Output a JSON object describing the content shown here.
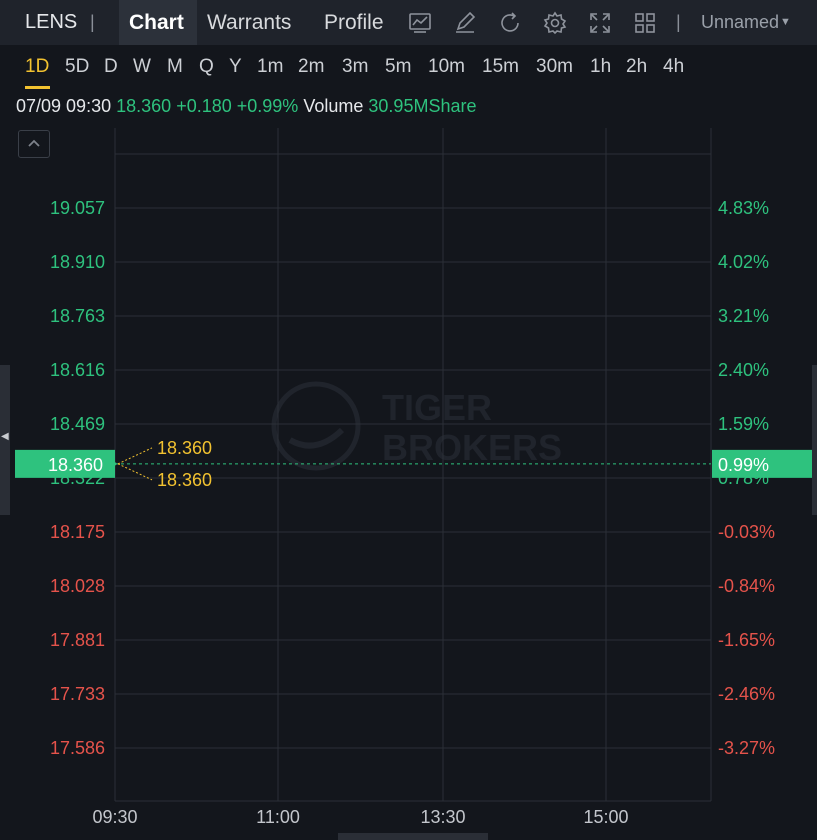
{
  "header": {
    "ticker": "LENS",
    "separator": "|",
    "tabs": [
      {
        "label": "Chart",
        "active": true
      },
      {
        "label": "Warrants",
        "active": false
      },
      {
        "label": "Profile",
        "active": false
      }
    ],
    "tools": [
      "indicator-chart-icon",
      "draw-pen-icon",
      "refresh-icon",
      "settings-gear-icon",
      "fullscreen-icon",
      "grid-layout-icon"
    ],
    "layout_name": "Unnamed"
  },
  "periods": [
    "1D",
    "5D",
    "D",
    "W",
    "M",
    "Q",
    "Y",
    "1m",
    "2m",
    "3m",
    "5m",
    "10m",
    "15m",
    "30m",
    "1h",
    "2h",
    "4h"
  ],
  "active_period": "1D",
  "quote": {
    "time": "07/09 09:30",
    "price": "18.360",
    "change": "+0.180",
    "change_pct": "+0.99%",
    "volume_label": "Volume",
    "volume": "30.95MShare"
  },
  "colors": {
    "up": "#2ec27e",
    "down": "#e5534b",
    "accent": "#f2c230",
    "background": "#13161c",
    "toolbar": "#1f232b",
    "current_tag": "#2ec27e"
  },
  "watermark": [
    "TIGER",
    "BROKERS"
  ],
  "chart_data": {
    "type": "line",
    "title": "",
    "xlabel": "",
    "ylabel": "",
    "x_ticks": [
      "09:30",
      "11:00",
      "13:30",
      "15:00"
    ],
    "y_ticks_left": [
      "19.057",
      "18.910",
      "18.763",
      "18.616",
      "18.469",
      "18.322",
      "18.175",
      "18.028",
      "17.881",
      "17.733",
      "17.586"
    ],
    "y_ticks_right": [
      "4.83%",
      "4.02%",
      "3.21%",
      "2.40%",
      "1.59%",
      "0.78%",
      "-0.03%",
      "-0.84%",
      "-1.65%",
      "-2.46%",
      "-3.27%"
    ],
    "ylim": [
      17.586,
      19.057
    ],
    "grid": true,
    "current_price": "18.360",
    "current_pct": "0.99%",
    "high_label": "18.360",
    "low_label": "18.360",
    "series": [
      {
        "x": [
          "09:30"
        ],
        "values": [
          18.36
        ]
      }
    ]
  }
}
